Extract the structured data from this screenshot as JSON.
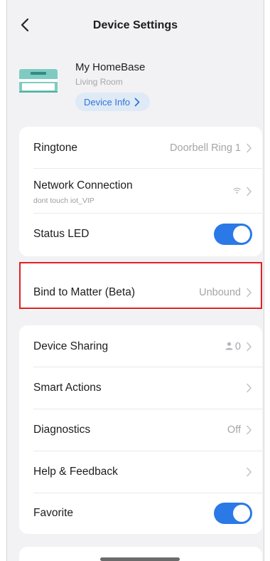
{
  "header": {
    "title": "Device Settings"
  },
  "device": {
    "name": "My HomeBase",
    "room": "Living Room",
    "info_button": "Device Info"
  },
  "settings": {
    "ringtone": {
      "label": "Ringtone",
      "value": "Doorbell Ring 1"
    },
    "network": {
      "label": "Network Connection",
      "ssid": "dont touch iot_VIP"
    },
    "status_led": {
      "label": "Status LED",
      "enabled": true
    },
    "matter": {
      "label": "Bind to Matter (Beta)",
      "value": "Unbound"
    },
    "sharing": {
      "label": "Device Sharing",
      "count": "0"
    },
    "smart_actions": {
      "label": "Smart Actions"
    },
    "diagnostics": {
      "label": "Diagnostics",
      "value": "Off"
    },
    "help": {
      "label": "Help & Feedback"
    },
    "favorite": {
      "label": "Favorite",
      "enabled": true
    }
  },
  "colors": {
    "accent": "#2a79e6",
    "highlight": "#e02222",
    "background": "#f2f2f4"
  }
}
